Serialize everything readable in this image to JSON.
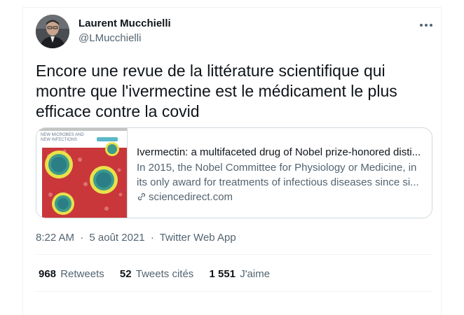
{
  "author": {
    "name": "Laurent Mucchielli",
    "handle": "@LMucchielli"
  },
  "tweet": {
    "text": "Encore une revue de la littérature scientifique qui montre que l'ivermectine est le médicament le plus efficace contre la covid"
  },
  "card": {
    "thumb_header_line1": "NEW MICROBES AND",
    "thumb_header_line2": "NEW INFECTIONS",
    "title": "Ivermectin: a multifaceted drug of Nobel prize-honored disti...",
    "desc_line1": "In 2015, the Nobel Committee for Physiology or Medicine, in",
    "desc_line2": "its only award for treatments of infectious diseases since si...",
    "domain": "sciencedirect.com"
  },
  "meta": {
    "time": "8:22 AM",
    "separator": "·",
    "date": "5 août 2021",
    "source": "Twitter Web App"
  },
  "stats": {
    "retweets_count": "968",
    "retweets_label": "Retweets",
    "quotes_count": "52",
    "quotes_label": "Tweets cités",
    "likes_count": "1 551",
    "likes_label": "J'aime"
  },
  "colors": {
    "text_primary": "#0f1419",
    "text_secondary": "#536471",
    "border": "#cfd9de",
    "divider": "#eff3f4"
  },
  "icons": {
    "more": "more-horizontal-icon",
    "link": "link-icon"
  }
}
